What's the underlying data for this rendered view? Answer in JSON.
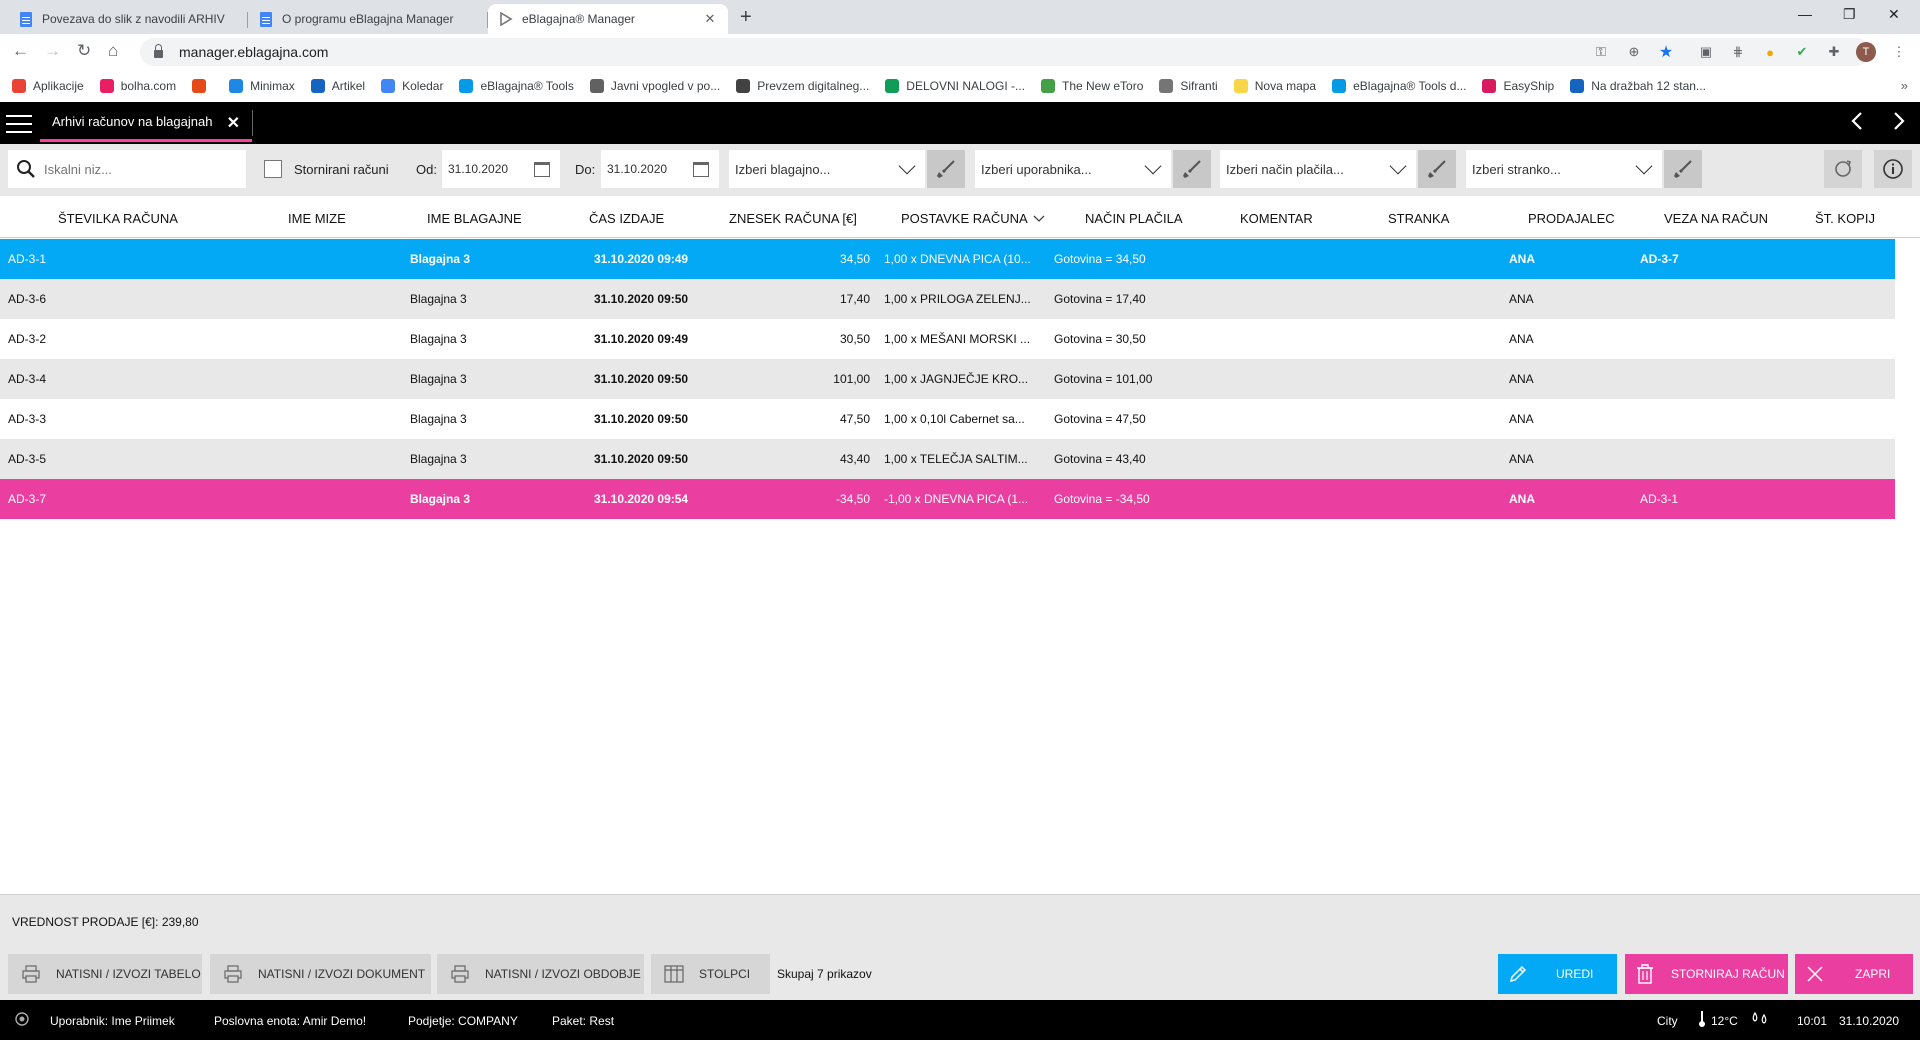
{
  "browser": {
    "tabs": [
      {
        "title": "Povezava do slik z navodili ARHIV",
        "active": false
      },
      {
        "title": "O programu eBlagajna Manager",
        "active": false
      },
      {
        "title": "eBlagajna® Manager",
        "active": true
      }
    ],
    "url": "manager.eblagajna.com",
    "profile_initial": "T",
    "bookmarks": [
      {
        "label": "Aplikacije",
        "color": "#ea4335"
      },
      {
        "label": "bolha.com",
        "color": "#e91e63"
      },
      {
        "label": "",
        "color": "#e64a19"
      },
      {
        "label": "Minimax",
        "color": "#1e88e5"
      },
      {
        "label": "Artikel",
        "color": "#1565c0"
      },
      {
        "label": "Koledar",
        "color": "#4285f4"
      },
      {
        "label": "eBlagajna® Tools",
        "color": "#039be5"
      },
      {
        "label": "Javni vpogled v po...",
        "color": "#616161"
      },
      {
        "label": "Prevzem digitalneg...",
        "color": "#424242"
      },
      {
        "label": "DELOVNI NALOGI -...",
        "color": "#0f9d58"
      },
      {
        "label": "The New eToro",
        "color": "#43a047"
      },
      {
        "label": "Sifranti",
        "color": "#757575"
      },
      {
        "label": "Nova mapa",
        "color": "#f9d648"
      },
      {
        "label": "eBlagajna® Tools d...",
        "color": "#039be5"
      },
      {
        "label": "EasyShip",
        "color": "#d81b60"
      },
      {
        "label": "Na dražbah 12 stan...",
        "color": "#1565c0"
      }
    ]
  },
  "app": {
    "tab_title": "Arhivi računov na blagajnah",
    "filters": {
      "search_placeholder": "Iskalni niz...",
      "storno_label": "Stornirani računi",
      "from_label": "Od:",
      "from_date": "31.10.2020",
      "to_label": "Do:",
      "to_date": "31.10.2020",
      "register_select": "Izberi blagajno...",
      "user_select": "Izberi uporabnika...",
      "payment_select": "Izberi način plačila...",
      "customer_select": "Izberi stranko..."
    },
    "columns": [
      "ŠTEVILKA RAČUNA",
      "IME MIZE",
      "IME BLAGAJNE",
      "ČAS IZDAJE",
      "ZNESEK RAČUNA [€]",
      "POSTAVKE RAČUNA",
      "NAČIN PLAČILA",
      "KOMENTAR",
      "STRANKA",
      "PRODAJALEC",
      "VEZA NA RAČUN",
      "ŠT. KOPIJ"
    ],
    "rows": [
      {
        "number": "AD-3-1",
        "table": "",
        "register": "Blagajna 3",
        "time": "31.10.2020 09:49",
        "amount": "34,50",
        "items": "1,00 x DNEVNA PICA (10...",
        "payment": "Gotovina = 34,50",
        "comment": "",
        "customer": "",
        "seller": "ANA",
        "link": "AD-3-7",
        "copies": "",
        "state": "selected"
      },
      {
        "number": "AD-3-6",
        "table": "",
        "register": "Blagajna 3",
        "time": "31.10.2020 09:50",
        "amount": "17,40",
        "items": "1,00 x PRILOGA ZELENJ...",
        "payment": "Gotovina = 17,40",
        "comment": "",
        "customer": "",
        "seller": "ANA",
        "link": "",
        "copies": "",
        "state": "alt"
      },
      {
        "number": "AD-3-2",
        "table": "",
        "register": "Blagajna 3",
        "time": "31.10.2020 09:49",
        "amount": "30,50",
        "items": "1,00 x MEŠANI MORSKI ...",
        "payment": "Gotovina = 30,50",
        "comment": "",
        "customer": "",
        "seller": "ANA",
        "link": "",
        "copies": "",
        "state": "normal"
      },
      {
        "number": "AD-3-4",
        "table": "",
        "register": "Blagajna 3",
        "time": "31.10.2020 09:50",
        "amount": "101,00",
        "items": "1,00 x JAGNJEČJE KRO...",
        "payment": "Gotovina = 101,00",
        "comment": "",
        "customer": "",
        "seller": "ANA",
        "link": "",
        "copies": "",
        "state": "alt"
      },
      {
        "number": "AD-3-3",
        "table": "",
        "register": "Blagajna 3",
        "time": "31.10.2020 09:50",
        "amount": "47,50",
        "items": "1,00 x 0,10l Cabernet sa...",
        "payment": "Gotovina = 47,50",
        "comment": "",
        "customer": "",
        "seller": "ANA",
        "link": "",
        "copies": "",
        "state": "normal"
      },
      {
        "number": "AD-3-5",
        "table": "",
        "register": "Blagajna 3",
        "time": "31.10.2020 09:50",
        "amount": "43,40",
        "items": "1,00 x TELEČJA SALTIM...",
        "payment": "Gotovina = 43,40",
        "comment": "",
        "customer": "",
        "seller": "ANA",
        "link": "",
        "copies": "",
        "state": "alt"
      },
      {
        "number": "AD-3-7",
        "table": "",
        "register": "Blagajna 3",
        "time": "31.10.2020 09:54",
        "amount": "-34,50",
        "items": "-1,00 x DNEVNA PICA (1...",
        "payment": "Gotovina = -34,50",
        "comment": "",
        "customer": "",
        "seller": "ANA",
        "link": "AD-3-1",
        "copies": "",
        "state": "storno"
      }
    ],
    "summary": "VREDNOST PRODAJE [€]: 239,80",
    "actions": {
      "print_table": "NATISNI / IZVOZI TABELO",
      "print_document": "NATISNI / IZVOZI DOKUMENT",
      "print_period": "NATISNI / IZVOZI OBDOBJE",
      "columns": "STOLPCI",
      "total": "Skupaj 7 prikazov",
      "edit": "UREDI",
      "storno": "STORNIRAJ RAČUN",
      "close": "ZAPRI"
    },
    "status": {
      "user": "Uporabnik: Ime Priimek",
      "unit": "Poslovna enota: Amir Demo!",
      "company": "Podjetje: COMPANY",
      "package": "Paket: Rest",
      "city": "City",
      "temperature": "12°C",
      "time": "10:01",
      "date": "31.10.2020"
    },
    "colors": {
      "accent_pink": "#ea3fa0",
      "accent_blue": "#03a9f4",
      "topbar": "#000000"
    }
  }
}
